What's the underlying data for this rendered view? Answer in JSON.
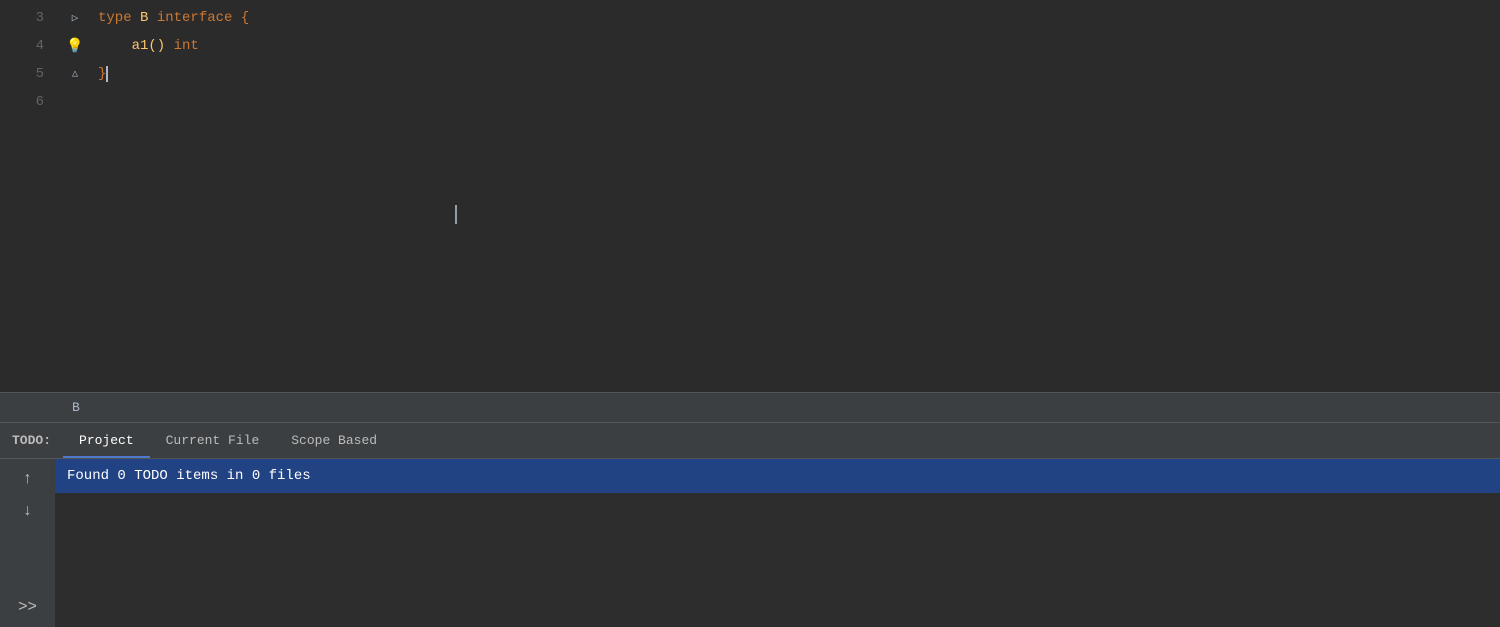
{
  "editor": {
    "background": "#2b2b2b",
    "lines": [
      {
        "number": "3",
        "gutter_icon": "collapse-arrow",
        "gutter_symbol": "▷",
        "content_parts": [
          {
            "text": "type",
            "class": "kw-type"
          },
          {
            "text": " B ",
            "class": "identifier"
          },
          {
            "text": "interface",
            "class": "kw-interface"
          },
          {
            "text": " {",
            "class": "punctuation"
          }
        ]
      },
      {
        "number": "4",
        "gutter_icon": "lightbulb",
        "gutter_symbol": "💡",
        "content_parts": [
          {
            "text": "    a1() ",
            "class": "method"
          },
          {
            "text": "int",
            "class": "kw-int"
          }
        ]
      },
      {
        "number": "5",
        "gutter_icon": "collapse-arrow",
        "gutter_symbol": "△",
        "content_parts": [
          {
            "text": "}",
            "class": "punctuation"
          },
          {
            "text": "|cursor|",
            "class": "cursor"
          }
        ]
      },
      {
        "number": "6",
        "gutter_icon": null,
        "gutter_symbol": "",
        "content_parts": []
      }
    ]
  },
  "file_tab": {
    "label": "B"
  },
  "todo": {
    "label": "TODO:",
    "tabs": [
      {
        "label": "Project",
        "active": true
      },
      {
        "label": "Current File",
        "active": false
      },
      {
        "label": "Scope Based",
        "active": false
      }
    ],
    "result_row": "Found 0 TODO items in 0 files",
    "up_arrow": "↑",
    "down_arrow": "↓",
    "expand_icon": ">>"
  }
}
